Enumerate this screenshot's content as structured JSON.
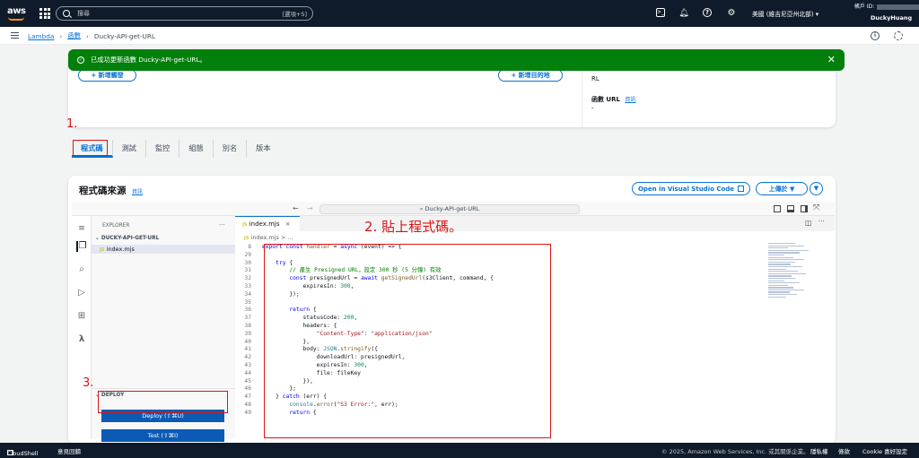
{
  "topnav": {
    "logo": "aws",
    "search_placeholder": "搜尋",
    "search_shortcut": "[選項+S]",
    "region": "美國 (維吉尼亞州北部)",
    "account_label": "帳戶 ID:",
    "username": "DuckyHuang"
  },
  "breadcrumb": {
    "items": [
      "Lambda",
      "函數",
      "Ducky-API-get-URL"
    ]
  },
  "flash": {
    "message": "已成功更新函數 Ducky-API-get-URL。"
  },
  "overview": {
    "add_trigger": "+ 新增觸發",
    "add_destination": "+ 新增目的地",
    "arn_partial": "RL",
    "function_url_label": "函數 URL",
    "function_url_info": "資訊",
    "function_url_value": "-"
  },
  "tabs": [
    "程式碼",
    "測試",
    "監控",
    "組態",
    "別名",
    "版本"
  ],
  "annotations": {
    "step1": "1.",
    "step2": "2. 貼上程式碼。",
    "step3": "3."
  },
  "code_source": {
    "title": "程式碼來源",
    "info": "資訊",
    "open_vscode": "Open in Visual Studio Code",
    "upload": "上傳於"
  },
  "ide": {
    "command_center": "Ducky-API-get-URL",
    "explorer_title": "EXPLORER",
    "folder": "DUCKY-API-GET-URL",
    "file": "index.mjs",
    "file_icon": "JS",
    "tab": "index.mjs",
    "editor_breadcrumb": "index.mjs > ...",
    "deploy_section": "DEPLOY",
    "deploy_button": "Deploy (⇧⌘U)",
    "test_button": "Test (⇧⌘I)"
  },
  "code_lines": [
    {
      "n": "8",
      "t": "export const handler = async (event) => {"
    },
    {
      "n": "29",
      "t": ""
    },
    {
      "n": "30",
      "t": "    try {"
    },
    {
      "n": "31",
      "t": "        // 產生 Presigned URL，設定 300 秒 (5 分鐘) 有效"
    },
    {
      "n": "32",
      "t": "        const presignedUrl = await getSignedUrl(s3Client, command, {"
    },
    {
      "n": "33",
      "t": "            expiresIn: 300,"
    },
    {
      "n": "34",
      "t": "        });"
    },
    {
      "n": "35",
      "t": ""
    },
    {
      "n": "36",
      "t": "        return {"
    },
    {
      "n": "37",
      "t": "            statusCode: 200,"
    },
    {
      "n": "38",
      "t": "            headers: {"
    },
    {
      "n": "39",
      "t": "                \"Content-Type\": \"application/json\""
    },
    {
      "n": "40",
      "t": "            },"
    },
    {
      "n": "41",
      "t": "            body: JSON.stringify({"
    },
    {
      "n": "42",
      "t": "                downloadUrl: presignedUrl,"
    },
    {
      "n": "43",
      "t": "                expiresIn: 300,"
    },
    {
      "n": "44",
      "t": "                file: fileKey"
    },
    {
      "n": "45",
      "t": "            }),"
    },
    {
      "n": "46",
      "t": "        };"
    },
    {
      "n": "47",
      "t": "    } catch (err) {"
    },
    {
      "n": "48",
      "t": "        console.error(\"S3 Error:\", err);"
    },
    {
      "n": "49",
      "t": "        return {"
    }
  ],
  "footer": {
    "cloudshell": "CloudShell",
    "feedback": "意見回饋",
    "copyright": "© 2025, Amazon Web Services, Inc. 或其關係企業。",
    "privacy": "隱私權",
    "terms": "條款",
    "cookies": "Cookie 喜好設定"
  },
  "colors": {
    "nav_bg": "#0f1b2a",
    "accent": "#0972d3",
    "success": "#037f0c",
    "annotation": "#d91515",
    "deploy_button": "#0b5bb5"
  }
}
